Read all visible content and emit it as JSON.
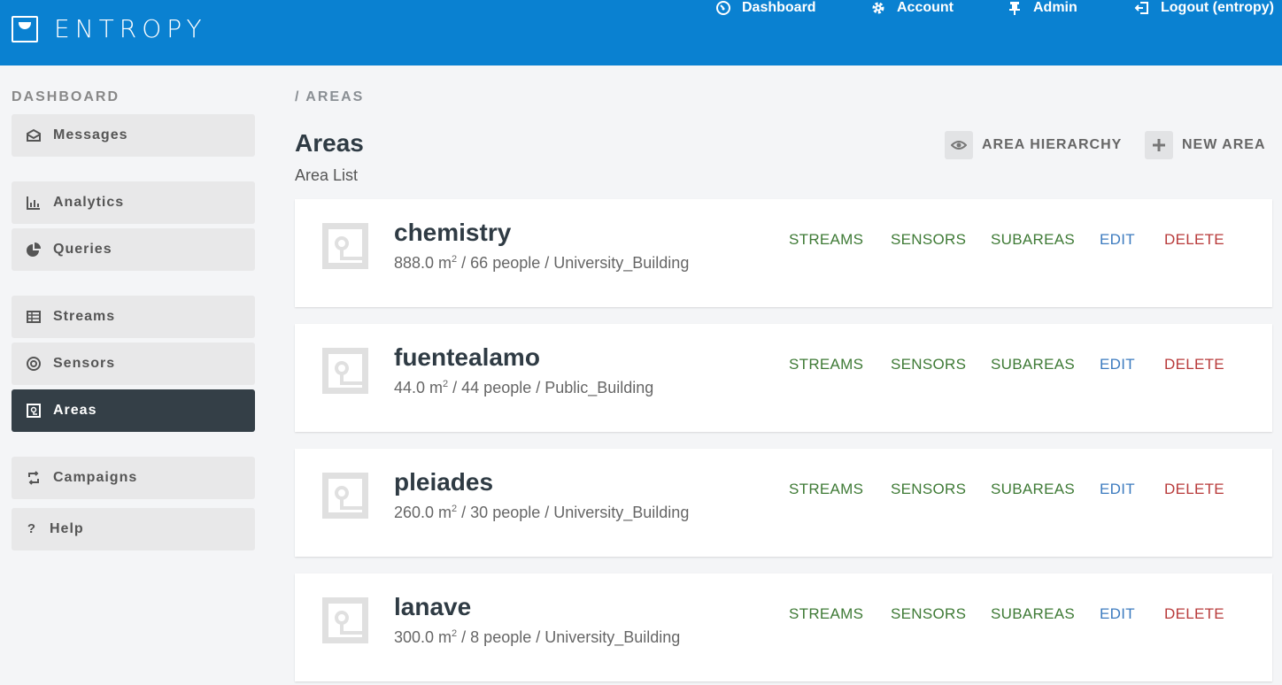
{
  "brand": {
    "name": "ENTROPY"
  },
  "topnav": {
    "dashboard": "Dashboard",
    "account": "Account",
    "admin": "Admin",
    "logout": "Logout (entropy)"
  },
  "sidebar": {
    "heading": "DASHBOARD",
    "items": [
      {
        "label": "Messages",
        "icon": "envelope-icon"
      },
      {
        "label": "Analytics",
        "icon": "bar-chart-icon"
      },
      {
        "label": "Queries",
        "icon": "pie-chart-icon"
      },
      {
        "label": "Streams",
        "icon": "table-icon"
      },
      {
        "label": "Sensors",
        "icon": "target-icon"
      },
      {
        "label": "Areas",
        "icon": "area-icon",
        "active": true
      },
      {
        "label": "Campaigns",
        "icon": "repeat-icon"
      },
      {
        "label": "Help",
        "icon": "question-icon"
      }
    ]
  },
  "breadcrumb": "/ AREAS",
  "page": {
    "title": "Areas",
    "subtitle": "Area List"
  },
  "actions": {
    "hierarchy": "AREA HIERARCHY",
    "new_area": "NEW AREA"
  },
  "links": {
    "streams": "STREAMS",
    "sensors": "SENSORS",
    "subareas": "SUBAREAS",
    "edit": "EDIT",
    "delete": "DELETE"
  },
  "areas": [
    {
      "name": "chemistry",
      "size": "888.0 m",
      "rest": " / 66 people / University_Building"
    },
    {
      "name": "fuentealamo",
      "size": "44.0 m",
      "rest": " / 44 people / Public_Building"
    },
    {
      "name": "pleiades",
      "size": "260.0 m",
      "rest": " / 30 people / University_Building"
    },
    {
      "name": "lanave",
      "size": "300.0 m",
      "rest": " / 8 people / University_Building"
    }
  ],
  "unit_exponent": "2",
  "colors": {
    "topbar": "#0a81d1",
    "sidebar_active": "#343f47",
    "link_green": "#3e7a35",
    "link_blue": "#3c7bbf",
    "link_red": "#b83a3a"
  }
}
